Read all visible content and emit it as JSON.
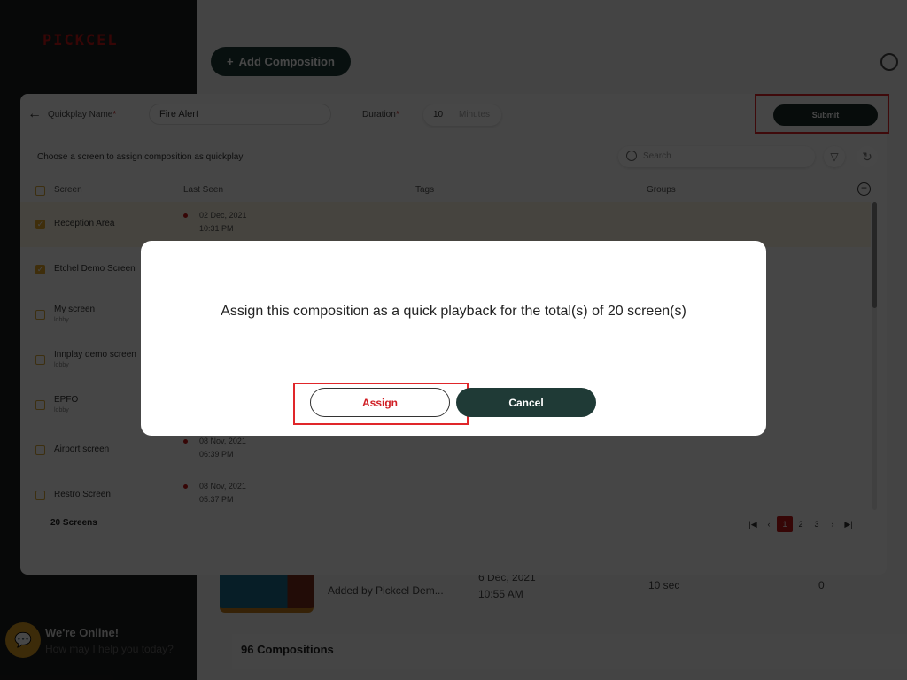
{
  "app": {
    "logo": "PICKCEL"
  },
  "background": {
    "add_composition_label": "Add Composition",
    "composition_row": {
      "added_by": "Added by Pickcel Dem...",
      "date": "6 Dec, 2021",
      "time": "10:55 AM",
      "duration": "10 sec",
      "count": "0"
    },
    "compositions_total": "96 Compositions",
    "chat": {
      "title": "We're Online!",
      "subtitle": "How may I help you today?"
    }
  },
  "quickplay": {
    "name_label": "Quickplay Name",
    "name_value": "Fire Alert",
    "duration_label": "Duration",
    "duration_value": "10",
    "duration_unit": "Minutes",
    "submit_label": "Submit",
    "instruction": "Choose a screen to assign composition as quickplay",
    "search_placeholder": "Search",
    "columns": {
      "screen": "Screen",
      "last_seen": "Last Seen",
      "tags": "Tags",
      "groups": "Groups"
    },
    "rows": [
      {
        "name": "Reception Area",
        "sub": "",
        "checked": true,
        "date": "02 Dec, 2021",
        "time": "10:31 PM"
      },
      {
        "name": "Etchel Demo Screen",
        "sub": "",
        "checked": true,
        "date": "",
        "time": ""
      },
      {
        "name": "My screen",
        "sub": "lobby",
        "checked": false,
        "date": "",
        "time": ""
      },
      {
        "name": "Innplay demo screen",
        "sub": "lobby",
        "checked": false,
        "date": "",
        "time": ""
      },
      {
        "name": "EPFO",
        "sub": "lobby",
        "checked": false,
        "date": "",
        "time": ""
      },
      {
        "name": "Airport screen",
        "sub": "",
        "checked": false,
        "date": "08 Nov, 2021",
        "time": "06:39 PM"
      },
      {
        "name": "Restro Screen",
        "sub": "",
        "checked": false,
        "date": "08 Nov, 2021",
        "time": "05:37 PM"
      }
    ],
    "screens_total": "20 Screens",
    "pagination": {
      "pages": [
        "1",
        "2",
        "3"
      ],
      "current": "1"
    }
  },
  "modal": {
    "message": "Assign this composition as a quick playback for the total(s) of 20 screen(s)",
    "assign_label": "Assign",
    "cancel_label": "Cancel"
  },
  "colors": {
    "accent": "#c01818",
    "primary_dark": "#1f3a36",
    "highlight": "#e0262a"
  }
}
